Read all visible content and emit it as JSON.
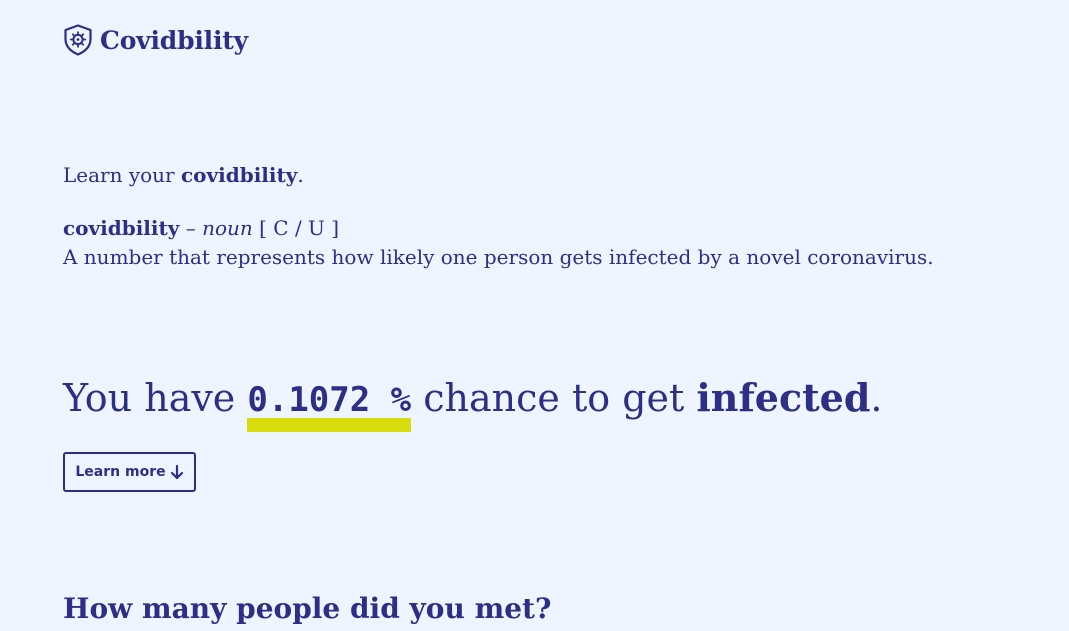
{
  "brand": {
    "name": "Covidbility",
    "icon": "virus-shield-icon"
  },
  "colors": {
    "background": "#eef5fe",
    "text": "#2d2f86",
    "highlight": "#d8dc0a"
  },
  "tagline": {
    "prefix": "Learn your ",
    "keyword": "covidbility",
    "suffix": "."
  },
  "definition": {
    "term": "covidbility",
    "dash": " – ",
    "part_of_speech": "noun",
    "grammar": " [ C / U ]",
    "meaning": "A number that represents how likely one person gets infected by a novel coronavirus."
  },
  "result": {
    "prefix": "You have ",
    "value": "0.1072 %",
    "middle": " chance to get ",
    "keyword": "infected",
    "suffix": "."
  },
  "learn_more": {
    "label": "Learn more",
    "icon": "arrow-down-icon"
  },
  "next_section": {
    "title": "How many people did you met?"
  }
}
